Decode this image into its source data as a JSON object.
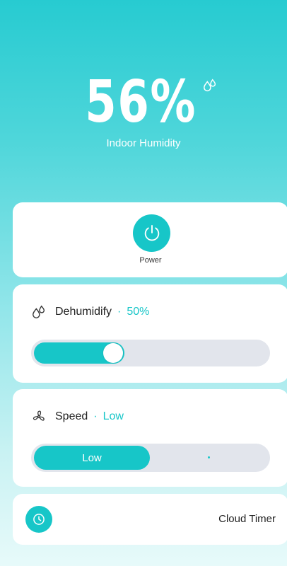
{
  "hero": {
    "humidity_value": "56",
    "humidity_unit": "%",
    "humidity_label": "Indoor Humidity"
  },
  "power": {
    "label": "Power"
  },
  "dehumidify": {
    "label": "Dehumidify",
    "separator": "·",
    "value_text": "50%",
    "value_fraction": 0.5
  },
  "speed": {
    "label": "Speed",
    "separator": "·",
    "value_text": "Low",
    "options": [
      "Low"
    ],
    "selected": "Low"
  },
  "timer": {
    "label": "Cloud Timer"
  },
  "colors": {
    "accent": "#17c6c8",
    "track": "#e2e5ec",
    "background_top": "#27cbd1"
  },
  "icons": {
    "humidity": "water-drops-icon",
    "power": "power-icon",
    "dehumidify": "water-drops-icon",
    "speed": "fan-icon",
    "timer": "clock-icon"
  }
}
